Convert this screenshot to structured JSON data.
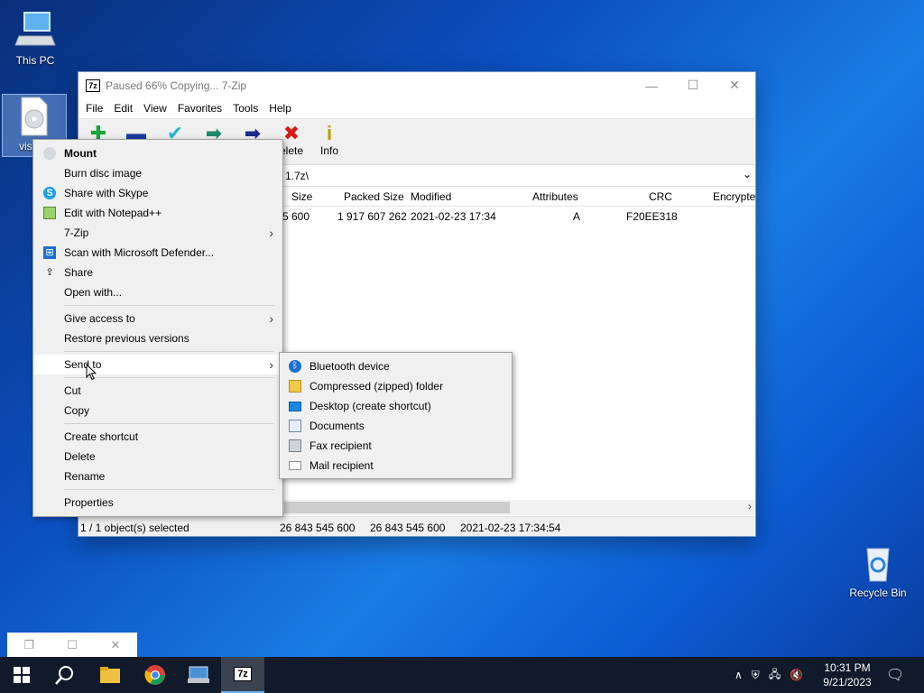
{
  "desktop": {
    "this_pc_label": "This PC",
    "selected_file_label": "vis",
    "recycle_bin_label": "Recycle Bin"
  },
  "window": {
    "title": "Paused 66% Copying... 7-Zip",
    "app_badge": "7z",
    "menu": [
      "File",
      "Edit",
      "View",
      "Favorites",
      "Tools",
      "Help"
    ],
    "toolbar": {
      "delete_label": "elete",
      "info_label": "Info"
    },
    "address": "1.7z\\",
    "columns": [
      "Size",
      "Packed Size",
      "Modified",
      "Attributes",
      "CRC",
      "Encrypte"
    ],
    "row": {
      "size": "5 600",
      "packed": "1 917 607 262",
      "modified": "2021-02-23 17:34",
      "attributes": "A",
      "crc": "F20EE318"
    },
    "status": {
      "selected": "1 / 1 object(s) selected",
      "size": "26 843 545 600",
      "packed": "26 843 545 600",
      "modified": "2021-02-23 17:34:54"
    }
  },
  "context_menu": {
    "items": [
      "Mount",
      "Burn disc image",
      "Share with Skype",
      "Edit with Notepad++",
      "7-Zip",
      "Scan with Microsoft Defender...",
      "Share",
      "Open with...",
      "Give access to",
      "Restore previous versions",
      "Send to",
      "Cut",
      "Copy",
      "Create shortcut",
      "Delete",
      "Rename",
      "Properties"
    ]
  },
  "send_to_menu": {
    "items": [
      "Bluetooth device",
      "Compressed (zipped) folder",
      "Desktop (create shortcut)",
      "Documents",
      "Fax recipient",
      "Mail recipient"
    ]
  },
  "taskbar": {
    "time": "10:31 PM",
    "date": "9/21/2023"
  },
  "colors": {
    "accent": "#0078d7",
    "taskbar": "#101a2a"
  }
}
